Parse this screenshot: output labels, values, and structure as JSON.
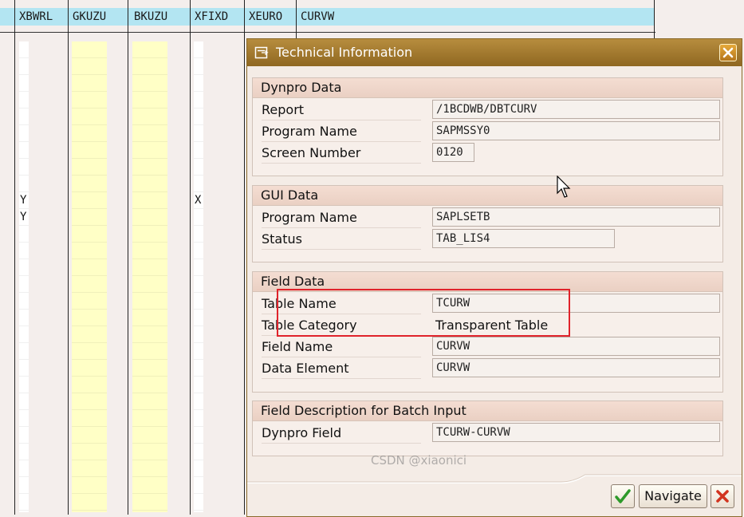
{
  "table": {
    "columns": [
      "XBWRL",
      "GKUZU",
      "BKUZU",
      "XFIXD",
      "XEURO",
      "CURVW"
    ],
    "xbwrl_values": [
      "Y",
      "Y"
    ],
    "xfixd_values": [
      "X"
    ]
  },
  "dialog": {
    "title": "Technical Information",
    "sections": {
      "dynpro": {
        "title": "Dynpro Data",
        "report_label": "Report",
        "report_value": "/1BCDWB/DBTCURV",
        "program_label": "Program Name",
        "program_value": "SAPMSSY0",
        "screen_label": "Screen Number",
        "screen_value": "0120"
      },
      "gui": {
        "title": "GUI Data",
        "program_label": "Program Name",
        "program_value": "SAPLSETB",
        "status_label": "Status",
        "status_value": "TAB_LIS4"
      },
      "field": {
        "title": "Field Data",
        "table_name_label": "Table Name",
        "table_name_value": "TCURW",
        "table_category_label": "Table Category",
        "table_category_value": "Transparent Table",
        "field_name_label": "Field Name",
        "field_name_value": "CURVW",
        "data_element_label": "Data Element",
        "data_element_value": "CURVW"
      },
      "batch": {
        "title": "Field Description for Batch Input",
        "dynpro_field_label": "Dynpro Field",
        "dynpro_field_value": "TCURW-CURVW"
      }
    },
    "buttons": {
      "navigate_label": "Navigate"
    }
  },
  "watermark": "CSDN @xiaonici",
  "colors": {
    "header_bg": "#b3e5f2",
    "title_bar": "#9c7329",
    "highlight": "#e0232b",
    "yellow_column": "#ffffc6"
  }
}
